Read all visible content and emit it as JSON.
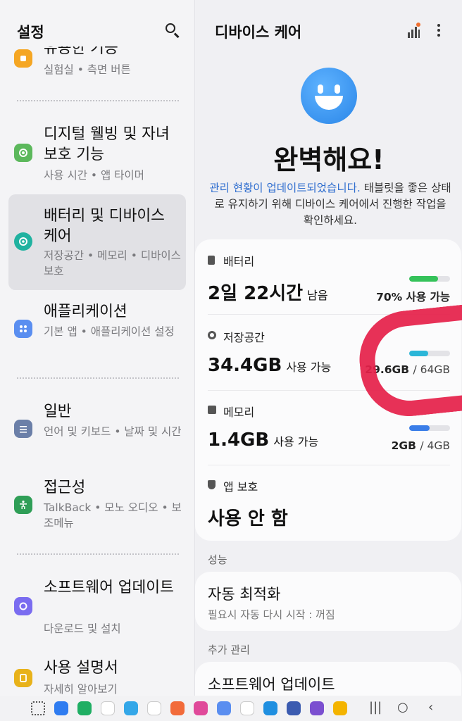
{
  "left": {
    "title": "설정",
    "items": [
      {
        "title": "유용한 기능",
        "subtitle": "실험실 • 측면 버튼",
        "icon": "puzzle-icon",
        "color": "#f5a623"
      },
      {
        "title": "디지털 웰빙 및 자녀 보호 기능",
        "subtitle": "사용 시간 • 앱 타이머",
        "icon": "wellbeing-icon",
        "color": "#5cb85c"
      },
      {
        "title": "배터리 및 디바이스 케어",
        "subtitle": "저장공간 • 메모리 • 디바이스 보호",
        "icon": "device-care-icon",
        "color": "#20b2a0"
      },
      {
        "title": "애플리케이션",
        "subtitle": "기본 앱 • 애플리케이션 설정",
        "icon": "apps-icon",
        "color": "#5a8ef0"
      },
      {
        "title": "일반",
        "subtitle": "언어 및 키보드 • 날짜 및 시간",
        "icon": "sliders-icon",
        "color": "#6b7fa8"
      },
      {
        "title": "접근성",
        "subtitle": "TalkBack • 모노 오디오 • 보조메뉴",
        "icon": "accessibility-icon",
        "color": "#2f9e57"
      },
      {
        "title": "소프트웨어 업데이트",
        "subtitle": "다운로드 및 설치",
        "icon": "update-icon",
        "color": "#7a6cf0"
      },
      {
        "title": "사용 설명서",
        "subtitle": "자세히 알아보기",
        "icon": "manual-icon",
        "color": "#e8b21a"
      }
    ]
  },
  "right": {
    "title": "디바이스 케어",
    "headline": "완벽해요!",
    "desc_link": "관리 현황이 업데이트되었습니다.",
    "desc_rest": " 태블릿을 좋은 상태로 유지하기 위해 디바이스 케어에서 진행한 작업을 확인하세요.",
    "battery": {
      "label": "배터리",
      "value": "2일 22시간",
      "suffix": "남음",
      "detail": "70% 사용 가능",
      "level": 0.7,
      "color": "#35c25a"
    },
    "storage": {
      "label": "저장공간",
      "value": "34.4GB",
      "suffix": "사용 가능",
      "used": "29.6GB",
      "total": "/ 64GB",
      "level": 0.46,
      "color": "#2bb6d8"
    },
    "memory": {
      "label": "메모리",
      "value": "1.4GB",
      "suffix": "사용 가능",
      "used": "2GB",
      "total": "/ 4GB",
      "level": 0.5,
      "color": "#3a7de8"
    },
    "protection": {
      "label": "앱 보호",
      "value": "사용 안 함"
    },
    "section_perf": "성능",
    "auto_opt": {
      "title": "자동 최적화",
      "subtitle": "필요시 자동 다시 시작 : 꺼짐"
    },
    "section_extra": "추가 관리",
    "sw_update": "소프트웨어 업데이트"
  },
  "nav": {
    "apps": [
      "grid-icon",
      "messages-icon",
      "green-c-app-icon",
      "smartthings-icon",
      "telegram-icon",
      "play-store-icon",
      "contacts-icon",
      "flower-app-icon",
      "gallery-icon",
      "chrome-icon",
      "edge-icon",
      "settings-icon",
      "multi-app-icon",
      "files-icon"
    ],
    "recent": "|||",
    "home": "○",
    "back": "‹"
  }
}
